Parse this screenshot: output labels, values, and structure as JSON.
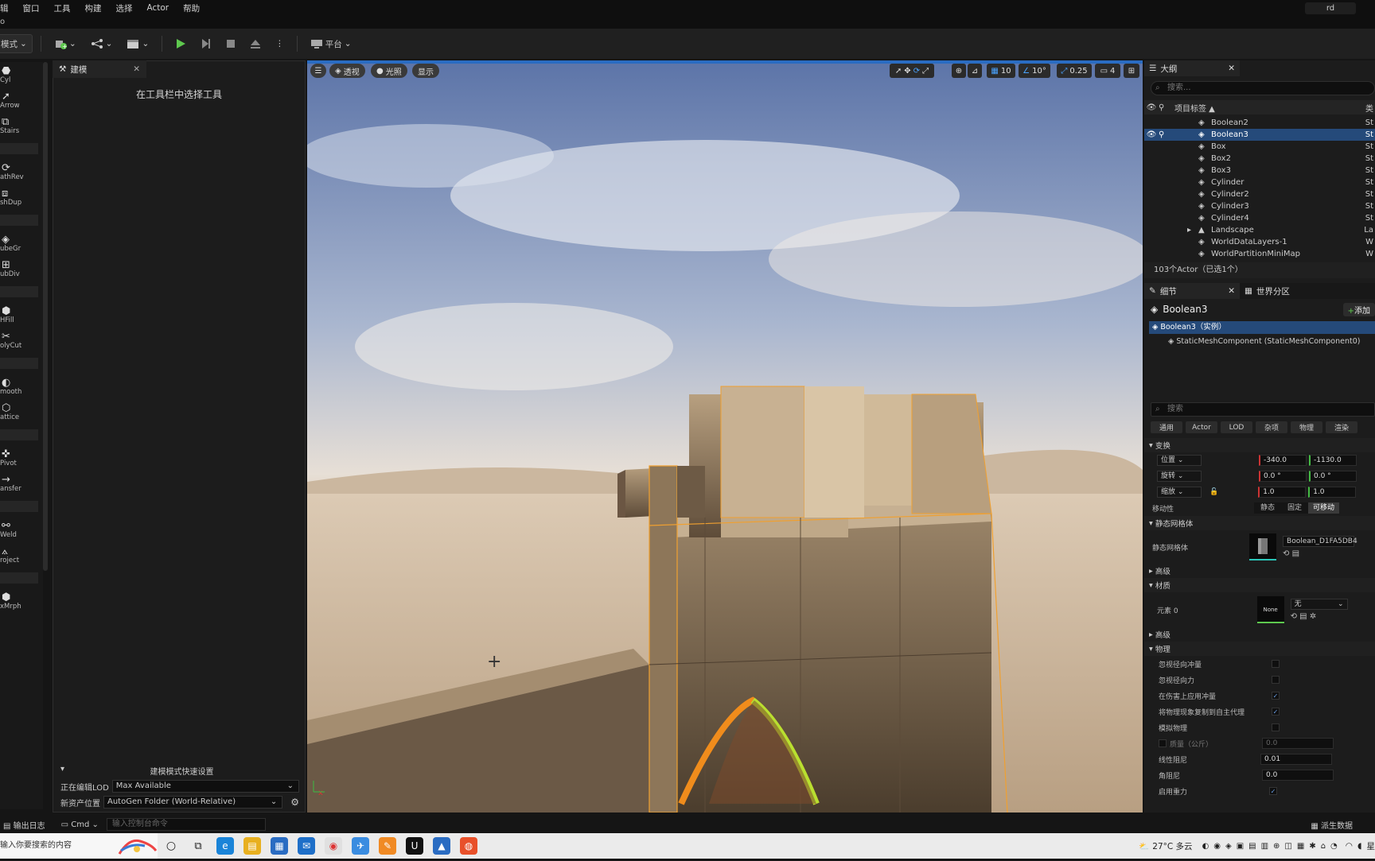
{
  "menu": [
    "辑",
    "窗口",
    "工具",
    "构建",
    "选择",
    "Actor",
    "帮助"
  ],
  "user_badge": "rd",
  "subbar_text": "o",
  "toolbar": {
    "modes": "模式",
    "platform": "平台"
  },
  "left_tools": [
    {
      "glyph": "⬣",
      "label": "Cyl"
    },
    {
      "glyph": "➚",
      "label": "Arrow"
    },
    {
      "glyph": "⧉",
      "label": "Stairs"
    },
    {
      "glyph": "⟳",
      "label": "athRev"
    },
    {
      "glyph": "⧈",
      "label": "shDup"
    },
    {
      "glyph": "◈",
      "label": "ubeGr"
    },
    {
      "glyph": "⊞",
      "label": "ubDiv"
    },
    {
      "glyph": "⬢",
      "label": "HFill"
    },
    {
      "glyph": "✂",
      "label": "olyCut"
    },
    {
      "glyph": "◐",
      "label": "mooth"
    },
    {
      "glyph": "⬡",
      "label": "attice"
    },
    {
      "glyph": "✜",
      "label": "Pivot"
    },
    {
      "glyph": "→",
      "label": "ansfer"
    },
    {
      "glyph": "⚯",
      "label": "Weld"
    },
    {
      "glyph": "⟑",
      "label": "roject"
    },
    {
      "glyph": "⬢",
      "label": "xMrph"
    }
  ],
  "modeling_panel": {
    "tab": "建模",
    "hint": "在工具栏中选择工具",
    "quick_settings": "建模模式快速设置",
    "lod_label": "正在编辑LOD",
    "lod_value": "Max Available",
    "asset_label": "新资产位置",
    "asset_value": "AutoGen Folder (World-Relative)"
  },
  "viewport": {
    "perspective": "透视",
    "lit": "光照",
    "show": "显示",
    "grid_snap": "10",
    "rot_snap": "10°",
    "scale_snap": "0.25",
    "cam_speed": "4"
  },
  "outliner": {
    "tab": "大纲",
    "search_placeholder": "搜索...",
    "col_label": "项目标签 ▲",
    "col_type": "类",
    "rows": [
      {
        "name": "Boolean2",
        "type": "St",
        "selected": false
      },
      {
        "name": "Boolean3",
        "type": "St",
        "selected": true
      },
      {
        "name": "Box",
        "type": "St",
        "selected": false
      },
      {
        "name": "Box2",
        "type": "St",
        "selected": false
      },
      {
        "name": "Box3",
        "type": "St",
        "selected": false
      },
      {
        "name": "Cylinder",
        "type": "St",
        "selected": false
      },
      {
        "name": "Cylinder2",
        "type": "St",
        "selected": false
      },
      {
        "name": "Cylinder3",
        "type": "St",
        "selected": false
      },
      {
        "name": "Cylinder4",
        "type": "St",
        "selected": false
      },
      {
        "name": "Landscape",
        "type": "La",
        "selected": false
      },
      {
        "name": "WorldDataLayers-1",
        "type": "W",
        "selected": false
      },
      {
        "name": "WorldPartitionMiniMap",
        "type": "W",
        "selected": false
      }
    ],
    "count": "103个Actor（已选1个）"
  },
  "details": {
    "tab": "细节",
    "tab2": "世界分区",
    "actor_name": "Boolean3",
    "add_button": "添加",
    "instance_row": "Boolean3（实例）",
    "component_row": "StaticMeshComponent (StaticMeshComponent0)",
    "search_placeholder": "搜索",
    "categories": [
      "通用",
      "Actor",
      "LOD",
      "杂项",
      "物理",
      "渲染"
    ],
    "transform_header": "变换",
    "location_label": "位置",
    "location_x": "-340.0",
    "location_y": "-1130.0",
    "rotation_label": "旋转",
    "rotation_x": "0.0 °",
    "rotation_y": "0.0 °",
    "scale_label": "缩放",
    "scale_x": "1.0",
    "scale_y": "1.0",
    "mobility_label": "移动性",
    "mobility_static": "静态",
    "mobility_stationary": "固定",
    "mobility_movable": "可移动",
    "static_mesh_header": "静态网格体",
    "static_mesh_label": "静态网格体",
    "static_mesh_value": "Boolean_D1FA5DB4",
    "advanced_1": "高级",
    "materials_header": "材质",
    "element0_label": "元素 0",
    "element0_thumb": "None",
    "element0_value": "无",
    "advanced_2": "高级",
    "physics_header": "物理",
    "physics_rows": [
      {
        "label": "忽视径向冲量",
        "checked": false
      },
      {
        "label": "忽视径向力",
        "checked": false
      },
      {
        "label": "在伤害上应用冲量",
        "checked": true
      },
      {
        "label": "将物理现象复制到自主代理",
        "checked": true
      },
      {
        "label": "模拟物理",
        "checked": false
      }
    ],
    "mass_label": "质量（公斤）",
    "mass_value": "0.0",
    "linear_damping_label": "线性阻尼",
    "linear_damping_value": "0.01",
    "angular_damping_label": "角阻尼",
    "angular_damping_value": "0.0",
    "gravity_label": "启用重力",
    "gravity_checked": true
  },
  "statusbar": {
    "output_log": "输出日志",
    "cmd": "Cmd",
    "cmd_placeholder": "输入控制台命令",
    "derived_data": "派生数据"
  },
  "taskbar": {
    "search_text": "输入你要搜索的内容",
    "weather": "27°C 多云",
    "clock": "星"
  },
  "colors": {
    "accent": "#2a6cc2",
    "selection": "#254a7a",
    "play": "#5ec84e"
  }
}
